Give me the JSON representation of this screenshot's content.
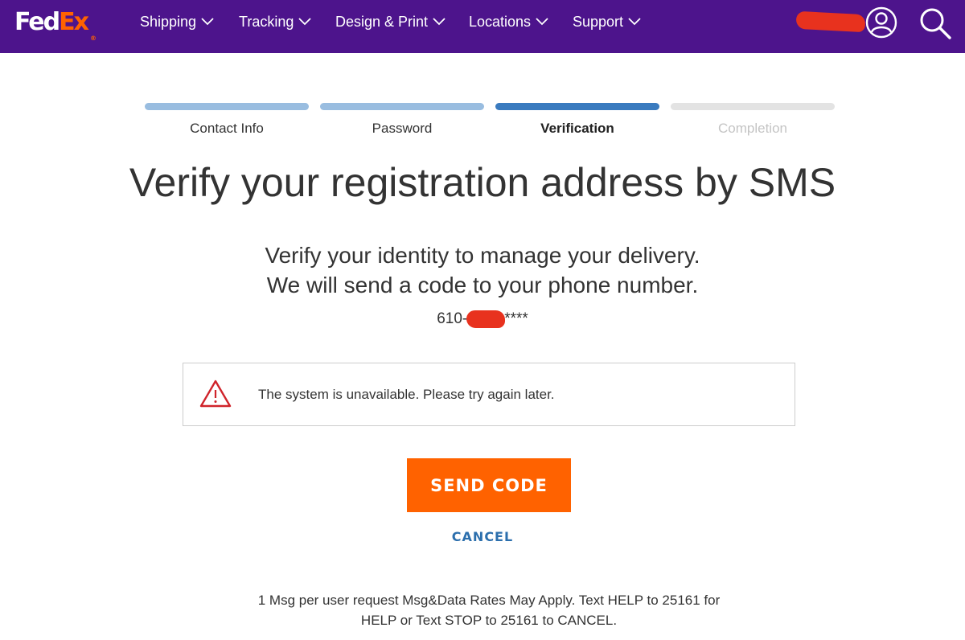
{
  "header": {
    "logo_fed": "Fed",
    "logo_ex": "Ex",
    "logo_reg": "®",
    "nav": [
      {
        "label": "Shipping"
      },
      {
        "label": "Tracking"
      },
      {
        "label": "Design & Print"
      },
      {
        "label": "Locations"
      },
      {
        "label": "Support"
      }
    ],
    "icons": [
      "account-icon",
      "search-icon"
    ]
  },
  "stepper": {
    "steps": [
      {
        "label": "Contact Info",
        "state": "completed"
      },
      {
        "label": "Password",
        "state": "completed"
      },
      {
        "label": "Verification",
        "state": "active"
      },
      {
        "label": "Completion",
        "state": "upcoming"
      }
    ]
  },
  "main": {
    "title": "Verify your registration address by SMS",
    "subtitle_line1": "Verify your identity to manage your delivery.",
    "subtitle_line2": "We will send a code to your phone number.",
    "phone_prefix": "610-",
    "phone_suffix": "****"
  },
  "alert": {
    "icon": "warning-triangle-icon",
    "message": "The system is unavailable. Please try again later."
  },
  "actions": {
    "send_label": "SEND CODE",
    "cancel_label": "CANCEL"
  },
  "disclaimer": {
    "line1": "1 Msg per user request Msg&Data Rates May Apply. Text HELP to 25161 for",
    "line2": "HELP or Text STOP to 25161 to CANCEL."
  },
  "colors": {
    "header_bg": "#4d148c",
    "brand_orange": "#ff6200",
    "step_completed": "#99bde0",
    "step_active": "#3a7bbf",
    "step_upcoming": "#e3e3e3",
    "link_blue": "#2c6fad",
    "alert_red": "#d0242b",
    "redaction": "#e8321e"
  }
}
